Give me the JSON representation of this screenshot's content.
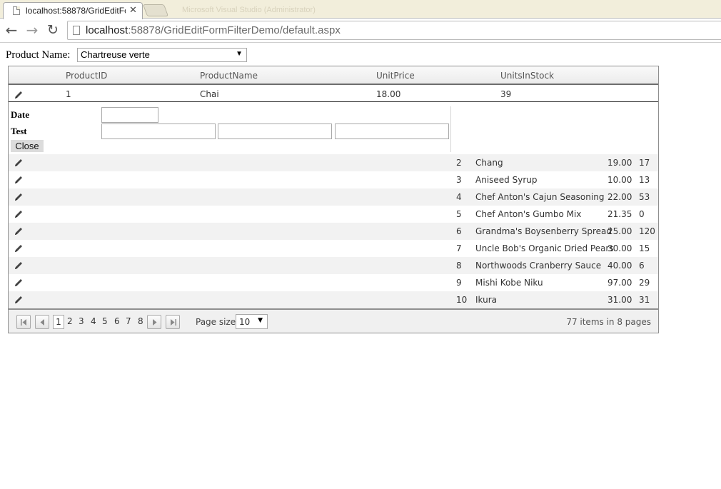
{
  "browser": {
    "tab_title": "localhost:58878/GridEditFc",
    "background_tab_text": "Microsoft Visual Studio (Administrator)",
    "url_host": "localhost",
    "url_rest": ":58878/GridEditFormFilterDemo/default.aspx"
  },
  "filter": {
    "label": "Product Name:",
    "selected": "Chartreuse verte"
  },
  "grid": {
    "columns": [
      "ProductID",
      "ProductName",
      "UnitPrice",
      "UnitsInStock"
    ],
    "edited_row": {
      "id": "1",
      "name": "Chai",
      "price": "18.00",
      "stock": "39"
    },
    "edit_form": {
      "date_label": "Date",
      "test_label": "Test",
      "close_label": "Close"
    },
    "rows": [
      {
        "id": "2",
        "name": "Chang",
        "price": "19.00",
        "stock": "17"
      },
      {
        "id": "3",
        "name": "Aniseed Syrup",
        "price": "10.00",
        "stock": "13"
      },
      {
        "id": "4",
        "name": "Chef Anton's Cajun Seasoning",
        "price": "22.00",
        "stock": "53"
      },
      {
        "id": "5",
        "name": "Chef Anton's Gumbo Mix",
        "price": "21.35",
        "stock": "0"
      },
      {
        "id": "6",
        "name": "Grandma's Boysenberry Spread",
        "price": "25.00",
        "stock": "120"
      },
      {
        "id": "7",
        "name": "Uncle Bob's Organic Dried Pears",
        "price": "30.00",
        "stock": "15"
      },
      {
        "id": "8",
        "name": "Northwoods Cranberry Sauce",
        "price": "40.00",
        "stock": "6"
      },
      {
        "id": "9",
        "name": "Mishi Kobe Niku",
        "price": "97.00",
        "stock": "29"
      },
      {
        "id": "10",
        "name": "Ikura",
        "price": "31.00",
        "stock": "31"
      }
    ],
    "pager": {
      "pages": [
        "1",
        "2",
        "3",
        "4",
        "5",
        "6",
        "7",
        "8"
      ],
      "current_page": "1",
      "page_size_label": "Page size:",
      "page_size": "10",
      "info": "77 items in 8 pages"
    }
  }
}
